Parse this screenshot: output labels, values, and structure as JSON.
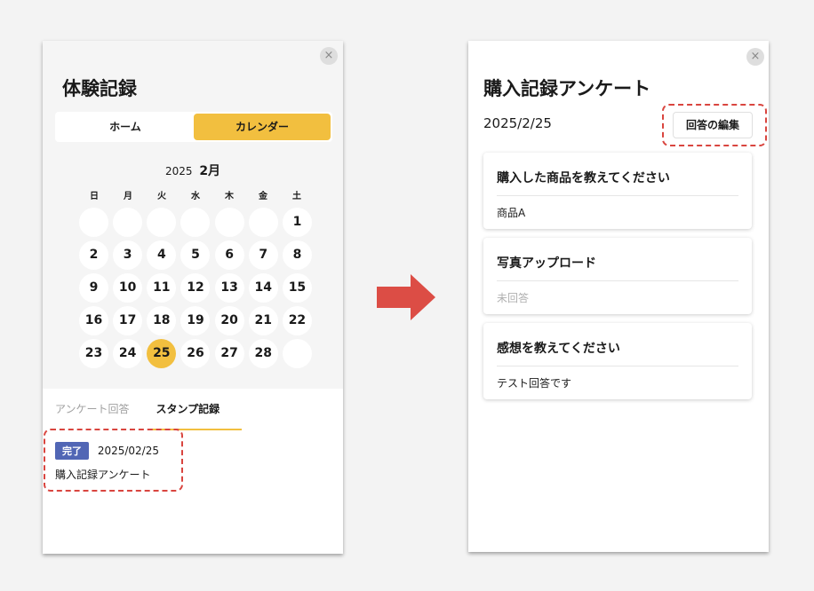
{
  "left_panel": {
    "close_icon": "×",
    "title": "体験記録",
    "segment": {
      "home_label": "ホーム",
      "calendar_label": "カレンダー",
      "active": "calendar"
    },
    "month": {
      "year": "2025",
      "month": "2月"
    },
    "weekdays": [
      "日",
      "月",
      "火",
      "水",
      "木",
      "金",
      "土"
    ],
    "weeks": [
      [
        "",
        "",
        "",
        "",
        "",
        "",
        "1"
      ],
      [
        "2",
        "3",
        "4",
        "5",
        "6",
        "7",
        "8"
      ],
      [
        "9",
        "10",
        "11",
        "12",
        "13",
        "14",
        "15"
      ],
      [
        "16",
        "17",
        "18",
        "19",
        "20",
        "21",
        "22"
      ],
      [
        "23",
        "24",
        "25",
        "26",
        "27",
        "28",
        ""
      ]
    ],
    "selected_day": "25",
    "tabs": {
      "survey_label": "アンケート回答",
      "stamp_label": "スタンプ記録",
      "active": "stamp"
    },
    "record": {
      "badge": "完了",
      "date": "2025/02/25",
      "title": "購入記録アンケート"
    }
  },
  "right_panel": {
    "close_icon": "×",
    "title": "購入記録アンケート",
    "date": "2025/2/25",
    "edit_button": "回答の編集",
    "cards": [
      {
        "question": "購入した商品を教えてください",
        "answer": "商品A",
        "answered": true
      },
      {
        "question": "写真アップロード",
        "answer": "未回答",
        "answered": false
      },
      {
        "question": "感想を教えてください",
        "answer": "テスト回答です",
        "answered": true
      }
    ]
  },
  "colors": {
    "accent": "#f2bf3f",
    "badge": "#5166b5",
    "highlight": "#d9453f",
    "arrow": "#dc4d45"
  }
}
